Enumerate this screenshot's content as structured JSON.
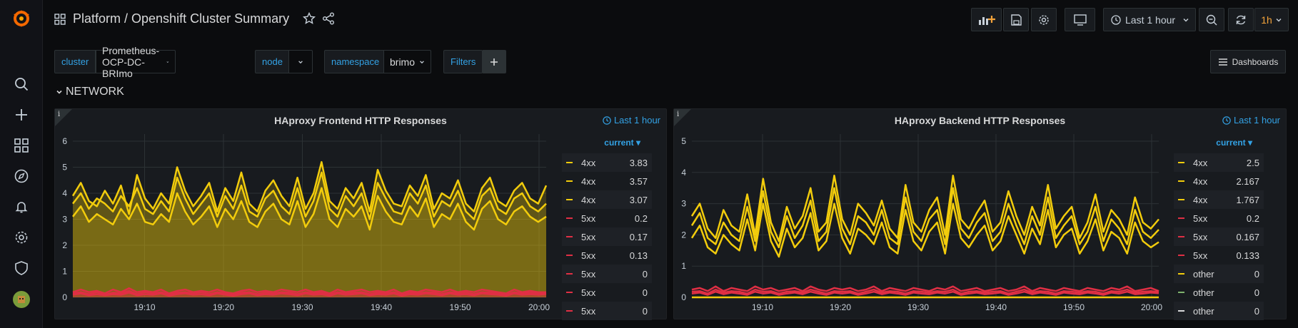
{
  "header": {
    "title": "Platform / Openshift Cluster Summary",
    "time_picker": "Last 1 hour",
    "refresh_interval": "1h",
    "dashboards_label": "Dashboards"
  },
  "variables": {
    "cluster_label": "cluster",
    "cluster_value": "Prometheus-OCP-DC-BRImo",
    "node_label": "node",
    "namespace_label": "namespace",
    "namespace_value": "brimo",
    "filters_label": "Filters"
  },
  "row": {
    "title": "NETWORK"
  },
  "colors": {
    "yellow": "#f2cc0c",
    "red": "#e02f44",
    "white": "#d8d9da",
    "accent": "#33a2e5"
  },
  "panels": [
    {
      "title": "HAproxy Frontend HTTP Responses",
      "time_info": "Last 1 hour",
      "legend_header": "current",
      "legend": [
        {
          "name": "4xx",
          "value": "3.83",
          "color": "#f2cc0c"
        },
        {
          "name": "4xx",
          "value": "3.57",
          "color": "#f2cc0c"
        },
        {
          "name": "4xx",
          "value": "3.07",
          "color": "#f2cc0c"
        },
        {
          "name": "5xx",
          "value": "0.2",
          "color": "#e02f44"
        },
        {
          "name": "5xx",
          "value": "0.17",
          "color": "#e02f44"
        },
        {
          "name": "5xx",
          "value": "0.13",
          "color": "#e02f44"
        },
        {
          "name": "5xx",
          "value": "0",
          "color": "#e02f44"
        },
        {
          "name": "5xx",
          "value": "0",
          "color": "#e02f44"
        },
        {
          "name": "5xx",
          "value": "0",
          "color": "#e02f44"
        }
      ],
      "chart_data": {
        "type": "area",
        "ylim": [
          0,
          6
        ],
        "yticks": [
          "0",
          "1",
          "2",
          "3",
          "4",
          "5",
          "6"
        ],
        "xticks": [
          "19:10",
          "19:20",
          "19:30",
          "19:40",
          "19:50",
          "20:00"
        ],
        "series": [
          {
            "values": [
              3.9,
              4.4,
              3.7,
              3.5,
              4.1,
              3.6,
              4.3,
              3.2,
              4.7,
              3.8,
              3.4,
              4.0,
              3.6,
              5.0,
              4.1,
              3.5,
              3.9,
              4.4,
              3.3,
              4.2,
              3.7,
              4.8,
              3.6,
              3.3,
              4.1,
              4.5,
              3.9,
              3.5,
              4.6,
              3.4,
              4.0,
              5.2,
              3.7,
              3.4,
              4.2,
              3.8,
              4.4,
              3.3,
              4.9,
              4.1,
              3.6,
              3.5,
              4.3,
              3.9,
              4.7,
              3.4,
              4.0,
              3.8,
              4.5,
              3.6,
              3.3,
              4.2,
              4.6,
              3.7,
              3.5,
              4.1,
              4.4,
              3.8,
              3.6,
              4.3
            ]
          },
          {
            "values": [
              3.6,
              4.0,
              3.4,
              3.8,
              3.6,
              3.3,
              3.9,
              3.5,
              4.2,
              3.4,
              3.2,
              3.7,
              3.3,
              4.6,
              3.8,
              3.2,
              3.6,
              4.0,
              3.1,
              3.9,
              3.4,
              4.3,
              3.3,
              3.1,
              3.8,
              4.1,
              3.5,
              3.2,
              4.2,
              3.1,
              3.7,
              4.8,
              3.4,
              3.1,
              3.9,
              3.5,
              4.0,
              3.0,
              4.4,
              3.8,
              3.3,
              3.2,
              4.0,
              3.6,
              4.3,
              3.1,
              3.7,
              3.5,
              4.1,
              3.3,
              3.0,
              3.9,
              4.2,
              3.4,
              3.2,
              3.8,
              4.0,
              3.5,
              3.3,
              3.6
            ]
          },
          {
            "values": [
              3.1,
              3.5,
              2.9,
              3.2,
              3.0,
              2.8,
              3.4,
              3.0,
              3.6,
              2.9,
              2.8,
              3.2,
              2.9,
              4.0,
              3.3,
              2.8,
              3.1,
              3.5,
              2.7,
              3.4,
              3.0,
              3.7,
              2.9,
              2.7,
              3.3,
              3.6,
              3.0,
              2.8,
              3.7,
              2.7,
              3.2,
              4.2,
              3.0,
              2.7,
              3.4,
              3.1,
              3.5,
              2.6,
              3.9,
              3.3,
              2.9,
              2.8,
              3.5,
              3.1,
              3.8,
              2.7,
              3.2,
              3.0,
              3.6,
              2.9,
              2.6,
              3.4,
              3.7,
              3.0,
              2.8,
              3.3,
              3.5,
              3.1,
              2.9,
              3.1
            ]
          },
          {
            "values": [
              0.2,
              0.3,
              0.2,
              0.25,
              0.15,
              0.3,
              0.2,
              0.35,
              0.2,
              0.25,
              0.2,
              0.3,
              0.15,
              0.25,
              0.3,
              0.2,
              0.25,
              0.2,
              0.3,
              0.2,
              0.15,
              0.25,
              0.3,
              0.2,
              0.25,
              0.2,
              0.3,
              0.25,
              0.2,
              0.3,
              0.2,
              0.25,
              0.15,
              0.3,
              0.2,
              0.25,
              0.3,
              0.2,
              0.25,
              0.2,
              0.3,
              0.15,
              0.25,
              0.2,
              0.3,
              0.25,
              0.2,
              0.3,
              0.2,
              0.25,
              0.2,
              0.3,
              0.25,
              0.2,
              0.15,
              0.3,
              0.2,
              0.25,
              0.2,
              0.2
            ]
          },
          {
            "values": [
              0.15,
              0.2,
              0.12,
              0.2,
              0.1,
              0.18,
              0.15,
              0.25,
              0.12,
              0.2,
              0.15,
              0.2,
              0.1,
              0.18,
              0.2,
              0.15,
              0.2,
              0.12,
              0.2,
              0.15,
              0.1,
              0.18,
              0.2,
              0.12,
              0.18,
              0.15,
              0.2,
              0.18,
              0.12,
              0.2,
              0.15,
              0.18,
              0.1,
              0.2,
              0.15,
              0.18,
              0.2,
              0.12,
              0.18,
              0.15,
              0.2,
              0.1,
              0.18,
              0.15,
              0.2,
              0.18,
              0.12,
              0.2,
              0.15,
              0.18,
              0.12,
              0.2,
              0.18,
              0.15,
              0.1,
              0.2,
              0.15,
              0.18,
              0.15,
              0.17
            ]
          },
          {
            "values": [
              0.1,
              0.15,
              0.08,
              0.12,
              0.08,
              0.12,
              0.1,
              0.18,
              0.08,
              0.12,
              0.1,
              0.15,
              0.06,
              0.12,
              0.15,
              0.1,
              0.12,
              0.08,
              0.15,
              0.1,
              0.06,
              0.12,
              0.15,
              0.08,
              0.12,
              0.1,
              0.15,
              0.12,
              0.08,
              0.15,
              0.1,
              0.12,
              0.06,
              0.15,
              0.1,
              0.12,
              0.15,
              0.08,
              0.12,
              0.1,
              0.15,
              0.06,
              0.12,
              0.1,
              0.15,
              0.12,
              0.08,
              0.15,
              0.1,
              0.12,
              0.08,
              0.15,
              0.12,
              0.1,
              0.06,
              0.15,
              0.1,
              0.12,
              0.1,
              0.13
            ]
          }
        ],
        "fill": true
      }
    },
    {
      "title": "HAproxy Backend HTTP Responses",
      "time_info": "Last 1 hour",
      "legend_header": "current",
      "legend": [
        {
          "name": "4xx",
          "value": "2.5",
          "color": "#f2cc0c"
        },
        {
          "name": "4xx",
          "value": "2.167",
          "color": "#f2cc0c"
        },
        {
          "name": "4xx",
          "value": "1.767",
          "color": "#f2cc0c"
        },
        {
          "name": "5xx",
          "value": "0.2",
          "color": "#e02f44"
        },
        {
          "name": "5xx",
          "value": "0.167",
          "color": "#e02f44"
        },
        {
          "name": "5xx",
          "value": "0.133",
          "color": "#e02f44"
        },
        {
          "name": "other",
          "value": "0",
          "color": "#f2cc0c"
        },
        {
          "name": "other",
          "value": "0",
          "color": "#7eb26d"
        },
        {
          "name": "other",
          "value": "0",
          "color": "#d8d9da"
        }
      ],
      "chart_data": {
        "type": "line",
        "ylim": [
          0,
          5
        ],
        "yticks": [
          "0",
          "1",
          "2",
          "3",
          "4",
          "5"
        ],
        "xticks": [
          "19:10",
          "19:20",
          "19:30",
          "19:40",
          "19:50",
          "20:00"
        ],
        "series": [
          {
            "values": [
              2.6,
              3.0,
              2.2,
              1.9,
              2.8,
              2.3,
              2.1,
              3.3,
              2.0,
              3.8,
              2.4,
              1.8,
              2.9,
              2.2,
              2.6,
              3.5,
              2.1,
              2.4,
              3.9,
              2.5,
              2.0,
              3.0,
              2.7,
              2.3,
              3.1,
              2.2,
              1.9,
              3.6,
              2.4,
              2.1,
              2.8,
              3.2,
              2.0,
              3.9,
              2.5,
              2.2,
              2.7,
              3.1,
              2.1,
              2.4,
              3.4,
              2.6,
              2.0,
              2.9,
              2.3,
              3.6,
              2.2,
              2.6,
              2.9,
              1.9,
              2.4,
              3.3,
              2.1,
              2.8,
              2.5,
              2.0,
              3.2,
              2.4,
              2.2,
              2.5
            ]
          },
          {
            "values": [
              2.3,
              2.7,
              1.9,
              1.7,
              2.4,
              2.0,
              1.8,
              2.9,
              1.8,
              3.4,
              2.1,
              1.6,
              2.6,
              1.9,
              2.3,
              3.1,
              1.8,
              2.1,
              3.5,
              2.2,
              1.7,
              2.6,
              2.4,
              2.0,
              2.8,
              1.9,
              1.7,
              3.2,
              2.1,
              1.8,
              2.5,
              2.8,
              1.7,
              3.5,
              2.2,
              1.9,
              2.4,
              2.7,
              1.8,
              2.1,
              3.0,
              2.3,
              1.7,
              2.6,
              2.0,
              3.2,
              1.9,
              2.3,
              2.6,
              1.7,
              2.1,
              2.9,
              1.8,
              2.5,
              2.2,
              1.7,
              2.8,
              2.1,
              1.9,
              2.17
            ]
          },
          {
            "values": [
              1.9,
              2.3,
              1.6,
              1.4,
              2.0,
              1.7,
              1.5,
              2.5,
              1.5,
              3.0,
              1.8,
              1.3,
              2.2,
              1.6,
              1.9,
              2.7,
              1.5,
              1.8,
              3.0,
              1.9,
              1.4,
              2.2,
              2.0,
              1.7,
              2.4,
              1.6,
              1.4,
              2.8,
              1.8,
              1.5,
              2.1,
              2.4,
              1.4,
              3.0,
              1.9,
              1.6,
              2.0,
              2.3,
              1.5,
              1.8,
              2.6,
              2.0,
              1.4,
              2.2,
              1.7,
              2.8,
              1.6,
              2.0,
              2.2,
              1.4,
              1.8,
              2.5,
              1.5,
              2.1,
              1.9,
              1.4,
              2.4,
              1.8,
              1.6,
              1.77
            ]
          },
          {
            "values": [
              0.25,
              0.3,
              0.2,
              0.35,
              0.2,
              0.3,
              0.25,
              0.2,
              0.35,
              0.25,
              0.3,
              0.2,
              0.25,
              0.3,
              0.2,
              0.35,
              0.25,
              0.2,
              0.3,
              0.25,
              0.3,
              0.2,
              0.25,
              0.35,
              0.2,
              0.3,
              0.25,
              0.2,
              0.3,
              0.25,
              0.2,
              0.3,
              0.25,
              0.35,
              0.2,
              0.25,
              0.3,
              0.2,
              0.25,
              0.3,
              0.2,
              0.25,
              0.35,
              0.2,
              0.3,
              0.25,
              0.2,
              0.3,
              0.25,
              0.2,
              0.3,
              0.25,
              0.2,
              0.3,
              0.25,
              0.35,
              0.2,
              0.25,
              0.3,
              0.2
            ]
          },
          {
            "values": [
              0.18,
              0.2,
              0.12,
              0.25,
              0.15,
              0.2,
              0.18,
              0.12,
              0.25,
              0.18,
              0.2,
              0.12,
              0.18,
              0.2,
              0.15,
              0.25,
              0.18,
              0.12,
              0.2,
              0.18,
              0.2,
              0.12,
              0.18,
              0.25,
              0.15,
              0.2,
              0.18,
              0.12,
              0.2,
              0.18,
              0.15,
              0.2,
              0.18,
              0.25,
              0.12,
              0.18,
              0.2,
              0.15,
              0.18,
              0.2,
              0.12,
              0.18,
              0.25,
              0.15,
              0.2,
              0.18,
              0.12,
              0.2,
              0.18,
              0.15,
              0.2,
              0.18,
              0.12,
              0.2,
              0.18,
              0.25,
              0.15,
              0.18,
              0.2,
              0.167
            ]
          },
          {
            "values": [
              0.12,
              0.15,
              0.08,
              0.18,
              0.1,
              0.15,
              0.12,
              0.08,
              0.18,
              0.12,
              0.15,
              0.08,
              0.12,
              0.15,
              0.1,
              0.18,
              0.12,
              0.08,
              0.15,
              0.12,
              0.15,
              0.08,
              0.12,
              0.18,
              0.1,
              0.15,
              0.12,
              0.08,
              0.15,
              0.12,
              0.1,
              0.15,
              0.12,
              0.18,
              0.08,
              0.12,
              0.15,
              0.1,
              0.12,
              0.15,
              0.08,
              0.12,
              0.18,
              0.1,
              0.15,
              0.12,
              0.08,
              0.15,
              0.12,
              0.1,
              0.15,
              0.12,
              0.08,
              0.15,
              0.12,
              0.18,
              0.1,
              0.12,
              0.15,
              0.133
            ]
          },
          {
            "values": [
              0,
              0,
              0,
              0,
              0,
              0,
              0,
              0,
              0,
              0,
              0,
              0,
              0,
              0,
              0,
              0,
              0,
              0,
              0,
              0,
              0,
              0,
              0,
              0,
              0,
              0,
              0,
              0,
              0,
              0,
              0,
              0,
              0,
              0,
              0,
              0,
              0,
              0,
              0,
              0,
              0,
              0,
              0,
              0,
              0,
              0,
              0,
              0,
              0,
              0,
              0,
              0,
              0,
              0,
              0,
              0,
              0,
              0,
              0,
              0
            ]
          }
        ],
        "fill": false
      }
    }
  ]
}
